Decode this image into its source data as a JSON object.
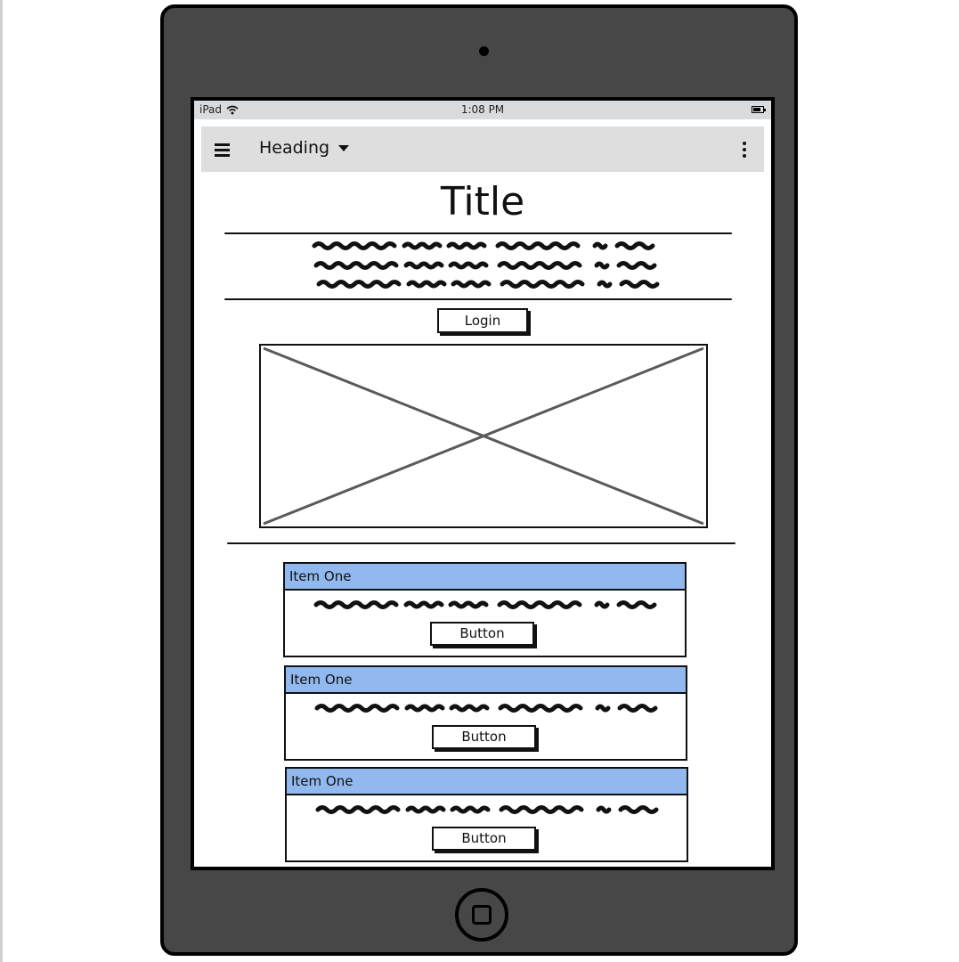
{
  "device": {
    "status_bar": {
      "carrier": "iPad",
      "time": "1:08 PM"
    }
  },
  "navbar": {
    "heading": "Heading"
  },
  "main": {
    "title": "Title",
    "login_label": "Login"
  },
  "cards": [
    {
      "title": "Item One",
      "button_label": "Button"
    },
    {
      "title": "Item One",
      "button_label": "Button"
    },
    {
      "title": "Item One",
      "button_label": "Button"
    }
  ],
  "colors": {
    "device_body": "#474747",
    "status_bar": "#d9dcdf",
    "navbar": "#dedede",
    "card_header": "#92b9ef"
  },
  "icons": [
    "camera-icon",
    "wifi-icon",
    "battery-icon",
    "hamburger-menu-icon",
    "caret-down-icon",
    "more-vertical-icon",
    "home-button-icon"
  ]
}
